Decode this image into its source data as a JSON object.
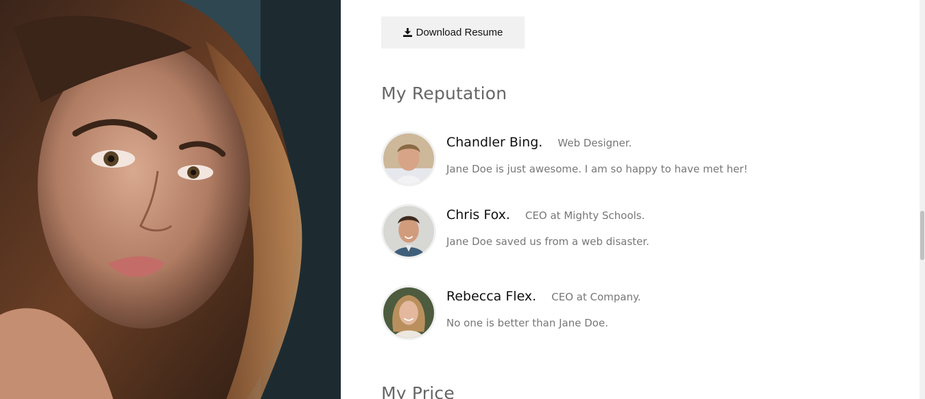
{
  "download": {
    "label": "Download Resume",
    "icon": "download-icon"
  },
  "reputation": {
    "title": "My Reputation",
    "reviews": [
      {
        "name": "Chandler Bing.",
        "role": "Web Designer.",
        "quote": "Jane Doe is just awesome. I am so happy to have met her!"
      },
      {
        "name": "Chris Fox.",
        "role": "CEO at Mighty Schools.",
        "quote": "Jane Doe saved us from a web disaster."
      },
      {
        "name": "Rebecca Flex.",
        "role": "CEO at Company.",
        "quote": "No one is better than Jane Doe."
      }
    ]
  },
  "price": {
    "title": "My Price"
  },
  "colors": {
    "button_bg": "#f1f1f1",
    "heading": "#666666",
    "text_muted": "#777777",
    "name": "#111111"
  }
}
